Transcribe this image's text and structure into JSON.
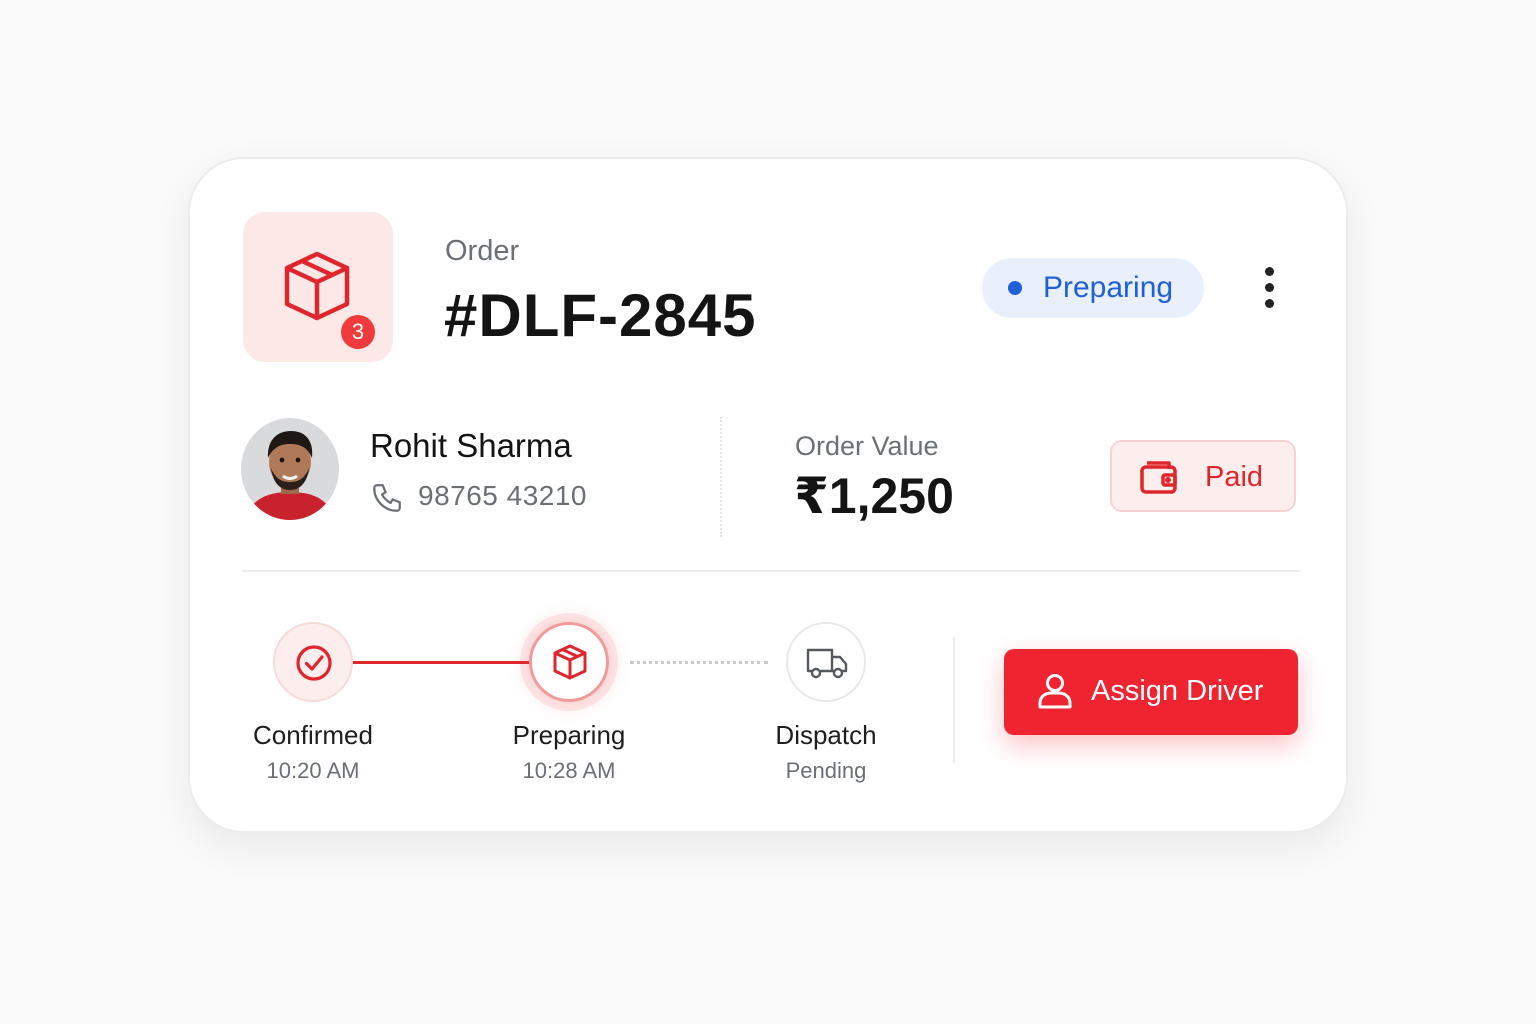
{
  "order": {
    "label": "Order",
    "id": "#DLF-2845",
    "item_count": "3",
    "icon": "package-icon"
  },
  "status": {
    "label": "Preparing",
    "color": "#1f5fd8",
    "bg": "#e9f0fc"
  },
  "menu": {
    "icon": "more-vertical-icon"
  },
  "customer": {
    "name": "Rohit Sharma",
    "phone": "98765 43210",
    "phone_icon": "phone-icon"
  },
  "order_value": {
    "label": "Order Value",
    "amount": "₹1,250"
  },
  "payment": {
    "label": "Paid",
    "icon": "wallet-icon"
  },
  "timeline": {
    "steps": [
      {
        "label": "Confirmed",
        "sub": "10:20 AM",
        "state": "done",
        "icon": "check-circle-icon"
      },
      {
        "label": "Preparing",
        "sub": "10:28 AM",
        "state": "active",
        "icon": "package-icon"
      },
      {
        "label": "Dispatch",
        "sub": "Pending",
        "state": "pending",
        "icon": "truck-icon"
      }
    ]
  },
  "actions": {
    "assign_driver_label": "Assign Driver",
    "assign_icon": "user-icon"
  },
  "colors": {
    "accent": "#ef2430",
    "accent_soft": "#fde8e8",
    "text_muted": "#6b6f76"
  }
}
